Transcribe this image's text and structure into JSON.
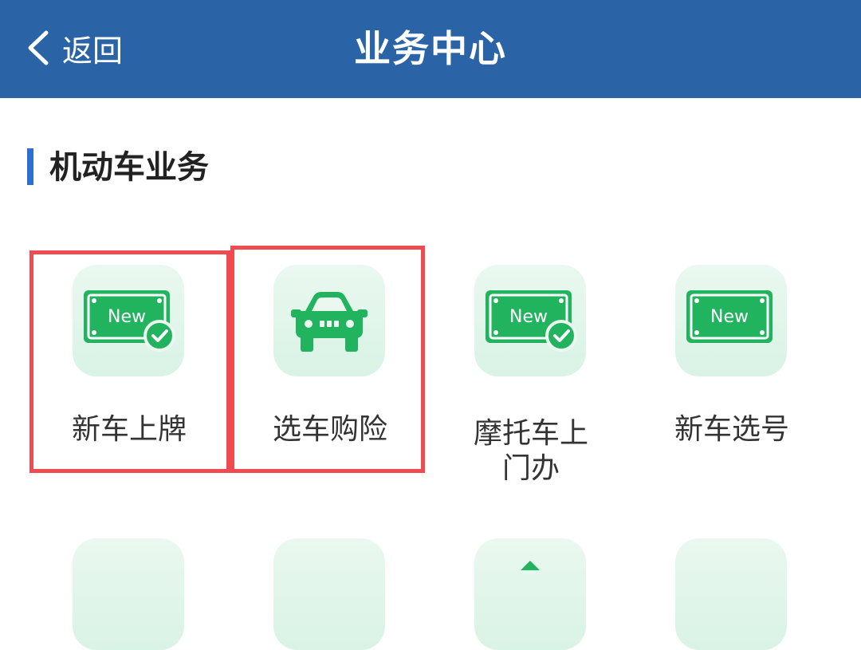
{
  "header": {
    "back_label": "返回",
    "title": "业务中心"
  },
  "section": {
    "title": "机动车业务"
  },
  "colors": {
    "header_bg": "#2a63a6",
    "accent": "#2d6fd0",
    "icon_green": "#21b35e",
    "highlight": "#ef4b50"
  },
  "tiles": [
    {
      "label": "新车上牌",
      "icon": "new-plate-check-icon",
      "highlighted": true
    },
    {
      "label": "选车购险",
      "icon": "car-front-icon",
      "highlighted": true
    },
    {
      "label": "摩托车上门办",
      "icon": "new-plate-check-icon",
      "highlighted": false
    },
    {
      "label": "新车选号",
      "icon": "new-plate-icon",
      "highlighted": false
    }
  ],
  "plate_badge_text": "New"
}
